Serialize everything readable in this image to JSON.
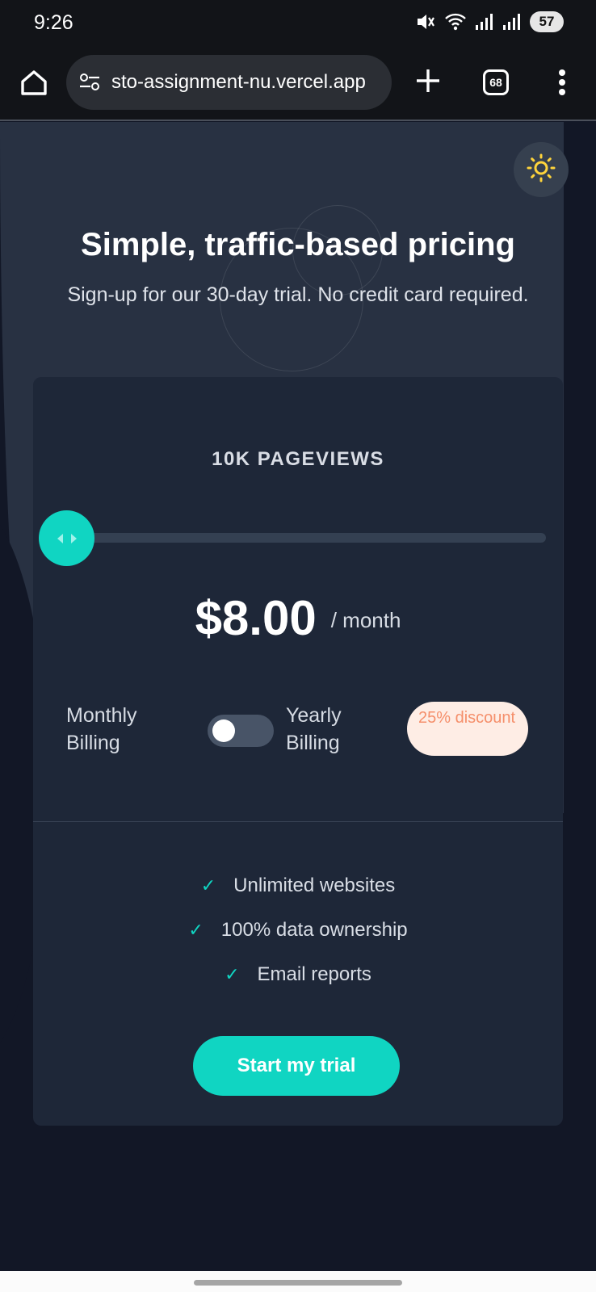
{
  "status_bar": {
    "time": "9:26",
    "battery": "57",
    "icons": [
      "mute-icon",
      "wifi-icon",
      "signal-icon",
      "signal-icon",
      "battery-icon"
    ]
  },
  "browser": {
    "url": "sto-assignment-nu.vercel.app",
    "tab_count": "68",
    "icons": [
      "home-icon",
      "site-settings-icon",
      "plus-icon",
      "tabs-icon",
      "more-vert-icon"
    ]
  },
  "hero": {
    "title": "Simple, traffic-based pricing",
    "subtitle": "Sign-up for our 30-day trial. No credit card required.",
    "theme_icon": "sun-icon",
    "accent_color": "#ffd43b"
  },
  "card": {
    "pageviews": "10K PAGEVIEWS",
    "slider": {
      "value": 0,
      "icon": "slider-arrows-icon",
      "color": "#10d5c2"
    },
    "price": "$8.00",
    "period": "/ month",
    "billing": {
      "monthly": "Monthly Billing",
      "yearly": "Yearly Billing",
      "yearly_enabled": false,
      "discount": "25% discount"
    },
    "features": [
      {
        "check": "✓",
        "label": "Unlimited websites"
      },
      {
        "check": "✓",
        "label": "100% data ownership"
      },
      {
        "check": "✓",
        "label": "Email reports"
      }
    ],
    "cta": "Start my trial"
  },
  "colors": {
    "primary": "#10d5c2",
    "background": "#121726",
    "card": "#1e2738",
    "discount_bg": "#feede5",
    "discount_text": "#f58f6b"
  }
}
